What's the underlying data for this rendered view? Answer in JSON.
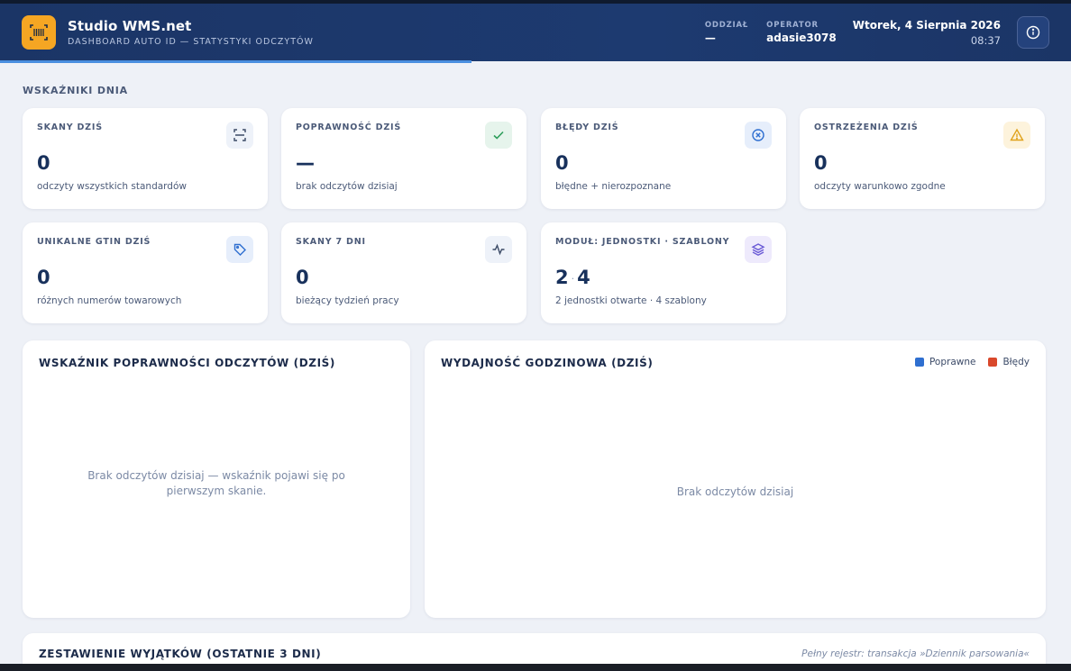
{
  "header": {
    "title": "Studio WMS.net",
    "subtitle": "DASHBOARD AUTO ID — STATYSTYKI ODCZYTÓW",
    "branch_label": "ODDZIAŁ",
    "branch_value": "—",
    "operator_label": "OPERATOR",
    "operator_value": "adasie3078",
    "date": "Wtorek, 4 Sierpnia 2026",
    "time": "08:37",
    "progress_fraction": 0.44
  },
  "section": {
    "title": "WSKAŹNIKI DNIA"
  },
  "kpis": [
    {
      "label": "SKANY DZIŚ",
      "value": "0",
      "sub": "odczyty wszystkich standardów",
      "icon": "scan-icon"
    },
    {
      "label": "POPRAWNOŚĆ DZIŚ",
      "value": "—",
      "sub": "brak odczytów dzisiaj",
      "icon": "check-icon"
    },
    {
      "label": "BŁĘDY DZIŚ",
      "value": "0",
      "sub": "błędne + nierozpoznane",
      "icon": "error-circle-icon"
    },
    {
      "label": "OSTRZEŻENIA DZIŚ",
      "value": "0",
      "sub": "odczyty warunkowo zgodne",
      "icon": "warning-icon"
    },
    {
      "label": "UNIKALNE GTIN DZIŚ",
      "value": "0",
      "sub": "różnych numerów towarowych",
      "icon": "tag-icon"
    },
    {
      "label": "SKANY 7 DNI",
      "value": "0",
      "sub": "bieżący tydzień pracy",
      "icon": "activity-icon"
    },
    {
      "label": "MODUŁ: JEDNOSTKI · SZABLONY",
      "value_a": "2",
      "value_sep": "·",
      "value_b": "4",
      "sub": "2 jednostki otwarte · 4 szablony",
      "icon": "layers-icon"
    }
  ],
  "panels": {
    "accuracy": {
      "title": "WSKAŹNIK POPRAWNOŚCI ODCZYTÓW (DZIŚ)",
      "empty": "Brak odczytów dzisiaj — wskaźnik pojawi się po pierwszym skanie."
    },
    "hourly": {
      "title": "WYDAJNOŚĆ GODZINOWA (DZIŚ)",
      "empty": "Brak odczytów dzisiaj",
      "legend": [
        {
          "label": "Poprawne",
          "color": "#2f6fd0"
        },
        {
          "label": "Błędy",
          "color": "#d9482b"
        }
      ]
    },
    "exceptions": {
      "title": "ZESTAWIENIE WYJĄTKÓW (OSTATNIE 3 DNI)",
      "note": "Pełny rejestr: transakcja »Dziennik parsowania«"
    }
  },
  "colors": {
    "header_bg": "#1b3566",
    "accent_orange": "#f5a623",
    "progress": "#4a8fe0",
    "success": "#2e9e5b",
    "error": "#2f6fd0",
    "warning": "#e0a21a",
    "purple": "#6b5bd6"
  }
}
